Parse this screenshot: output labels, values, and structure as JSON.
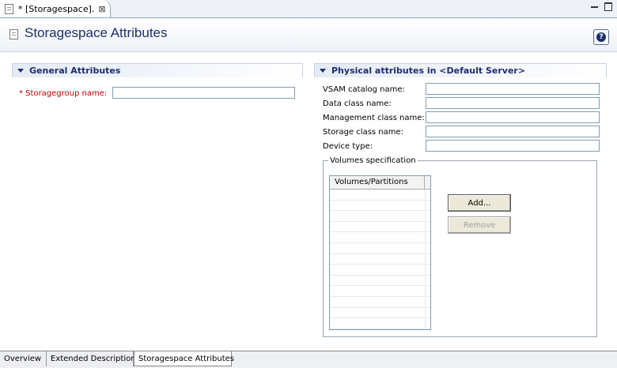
{
  "editor": {
    "tab_title": "* [Storagespace].",
    "tab_close": "⊠",
    "header_title": "Storagespace Attributes",
    "help_icon": "?"
  },
  "general": {
    "section_title": "General Attributes",
    "storagegroup_label": "* Storagegroup name:",
    "storagegroup_value": ""
  },
  "physical": {
    "section_title": "Physical attributes in <Default Server>",
    "fields": [
      {
        "label": "VSAM catalog name:",
        "value": ""
      },
      {
        "label": "Data class name:",
        "value": ""
      },
      {
        "label": "Management class name:",
        "value": ""
      },
      {
        "label": "Storage class name:",
        "value": ""
      },
      {
        "label": "Device type:",
        "value": ""
      }
    ],
    "volumes": {
      "group_title": "Volumes specification",
      "column_header": "Volumes/Partitions",
      "rows": [],
      "add_label": "Add...",
      "remove_label": "Remove"
    }
  },
  "bottom_tabs": [
    {
      "label": "Overview",
      "active": false
    },
    {
      "label": "Extended Description",
      "active": false
    },
    {
      "label": "Storagespace Attributes",
      "active": true
    }
  ],
  "colors": {
    "header_title": "#1c2f6e",
    "required_label": "#c00000",
    "section_gradient_start": "#e4ebf6"
  }
}
